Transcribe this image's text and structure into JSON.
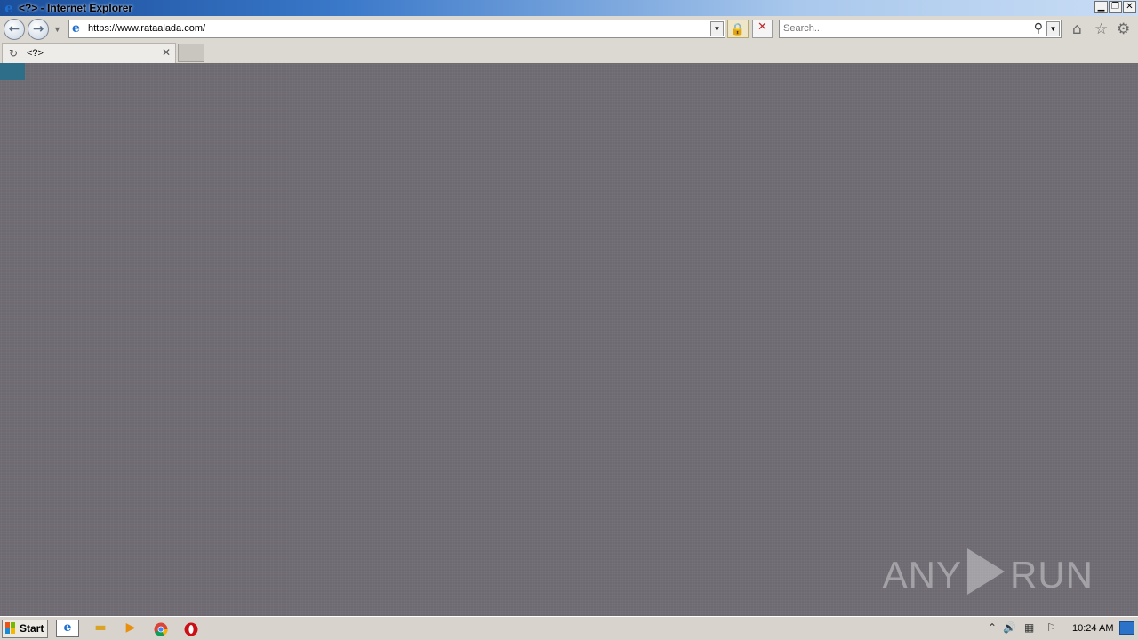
{
  "window": {
    "title": "<?> - Internet Explorer",
    "controls": {
      "minimize": "▁",
      "restore": "❐",
      "close": "✕"
    }
  },
  "toolbar": {
    "back_icon": "back-arrow-icon",
    "forward_icon": "forward-arrow-icon",
    "address_url": "https://www.rataalada.com/",
    "lock_icon": "padlock-icon",
    "stop_icon": "stop-x-icon",
    "search_placeholder": "Search...",
    "home_icon": "home-icon",
    "favorites_icon": "star-icon",
    "tools_icon": "gear-icon"
  },
  "tabs": [
    {
      "title": "<?>",
      "loading": true,
      "close_label": "✕"
    }
  ],
  "content": {
    "background_color": "#6f6a72",
    "watermark_left": "ANY",
    "watermark_right": "RUN"
  },
  "taskbar": {
    "start_label": "Start",
    "pinned": [
      "internet-explorer-icon",
      "file-explorer-icon",
      "media-player-icon",
      "chrome-icon",
      "opera-icon"
    ],
    "clock": "10:24 AM"
  }
}
